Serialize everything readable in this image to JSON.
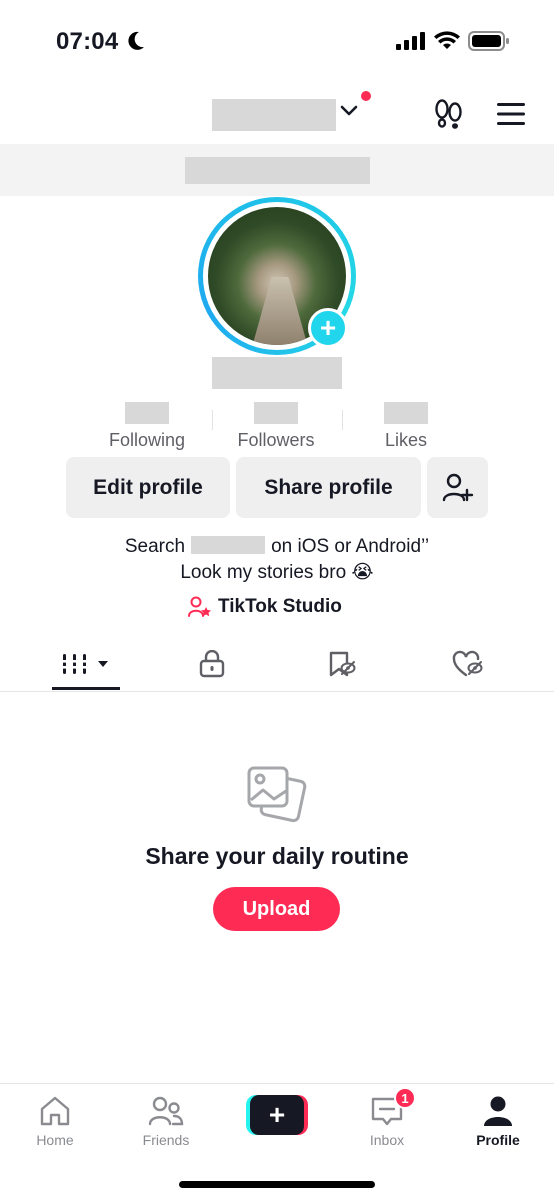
{
  "status_bar": {
    "time": "07:04",
    "icons": [
      "moon-icon",
      "signal-icon",
      "wifi-icon",
      "battery-icon"
    ]
  },
  "header": {
    "icons": [
      "chevron-down-icon",
      "footprint-icon",
      "menu-icon"
    ],
    "notification_dot_color": "#fe2c55"
  },
  "stats": [
    {
      "label": "Following"
    },
    {
      "label": "Followers"
    },
    {
      "label": "Likes"
    }
  ],
  "buttons": {
    "edit_profile": "Edit profile",
    "share_profile": "Share profile",
    "add_friend_icon": "add-friend-icon"
  },
  "bio": {
    "line1_prefix": "Search",
    "line1_suffix": "on iOS or Android’’",
    "line2": "Look my stories bro 😭"
  },
  "studio": {
    "label": "TikTok Studio",
    "icon": "studio-icon"
  },
  "tabs": [
    {
      "icon": "videos-grid-icon",
      "active": true
    },
    {
      "icon": "lock-icon",
      "active": false
    },
    {
      "icon": "bookmark-icon",
      "active": false
    },
    {
      "icon": "heart-icon",
      "active": false
    }
  ],
  "empty_state": {
    "icon": "photos-icon",
    "title": "Share your daily routine",
    "button": "Upload"
  },
  "bottom_nav": {
    "items": [
      {
        "label": "Home",
        "icon": "home-icon"
      },
      {
        "label": "Friends",
        "icon": "friends-icon"
      },
      {
        "label": "",
        "icon": "create-icon"
      },
      {
        "label": "Inbox",
        "icon": "inbox-icon",
        "badge": "1"
      },
      {
        "label": "Profile",
        "icon": "profile-icon",
        "active": true
      }
    ]
  },
  "colors": {
    "accent": "#fe2c55",
    "ring": "#20d5ec",
    "text": "#161823"
  }
}
